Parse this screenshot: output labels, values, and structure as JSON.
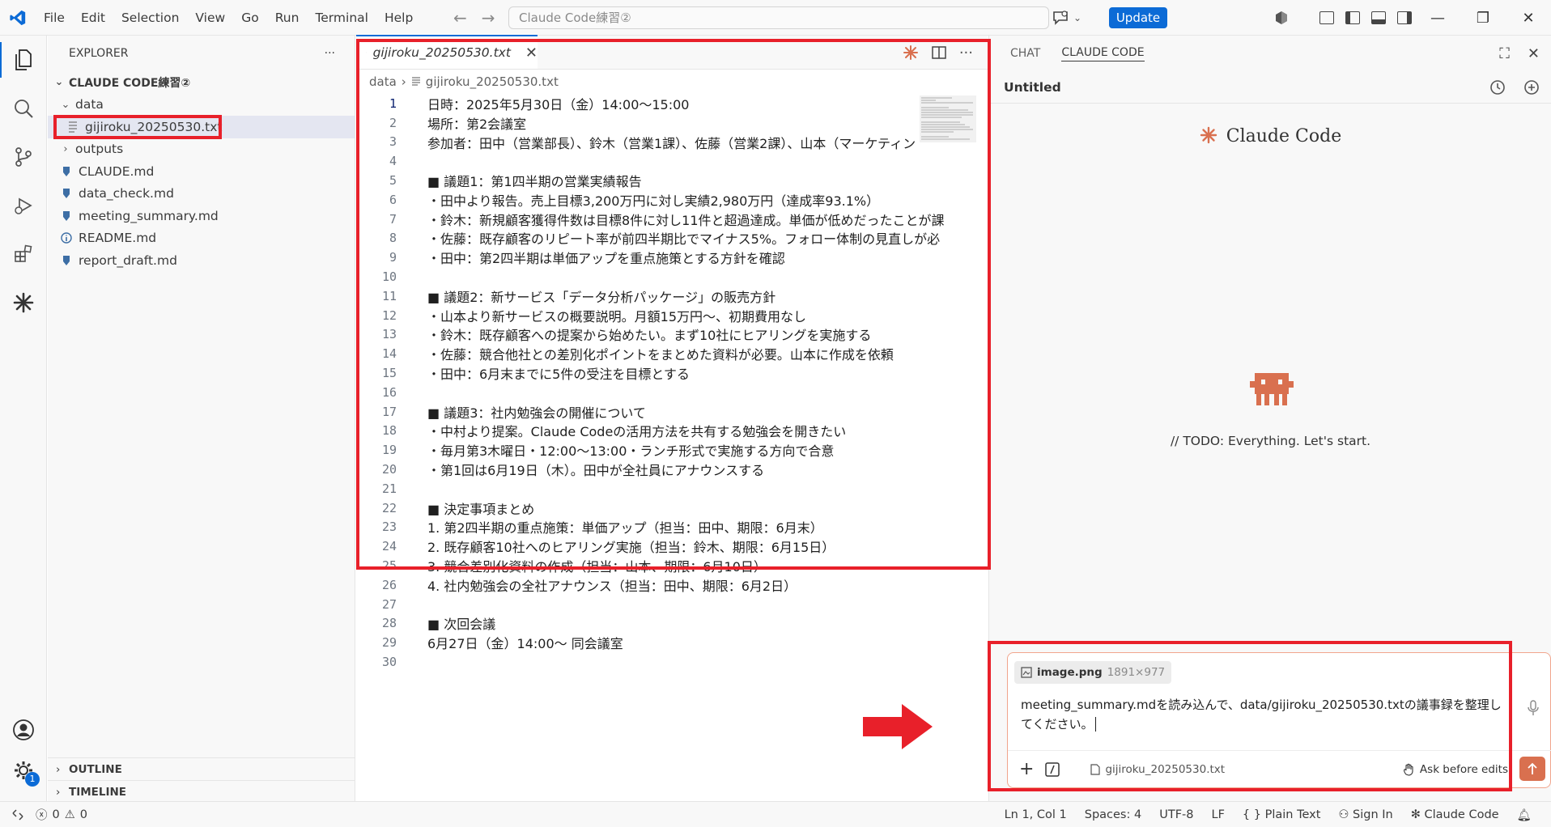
{
  "titlebar": {
    "menu": [
      "File",
      "Edit",
      "Selection",
      "View",
      "Go",
      "Run",
      "Terminal",
      "Help"
    ],
    "search_text": "Claude Code練習②",
    "update_label": "Update"
  },
  "explorer": {
    "title": "EXPLORER",
    "more": "···",
    "root": "CLAUDE CODE練習②",
    "folder_data": "data",
    "selected_file": "gijiroku_20250530.txt",
    "folder_outputs": "outputs",
    "files": [
      "CLAUDE.md",
      "data_check.md",
      "meeting_summary.md",
      "README.md",
      "report_draft.md"
    ],
    "outline": "OUTLINE",
    "timeline": "TIMELINE",
    "settings_badge": "1"
  },
  "editor": {
    "tab_label": "gijiroku_20250530.txt",
    "breadcrumb_folder": "data",
    "breadcrumb_file": "gijiroku_20250530.txt",
    "lines": [
      "日時：2025年5月30日（金）14:00〜15:00",
      "場所：第2会議室",
      "参加者：田中（営業部長）、鈴木（営業1課）、佐藤（営業2課）、山本（マーケティン",
      "",
      "■ 議題1：第1四半期の営業実績報告",
      "・田中より報告。売上目標3,200万円に対し実績2,980万円（達成率93.1%）",
      "・鈴木：新規顧客獲得件数は目標8件に対し11件と超過達成。単価が低めだったことが課",
      "・佐藤：既存顧客のリピート率が前四半期比でマイナス5%。フォロー体制の見直しが必",
      "・田中：第2四半期は単価アップを重点施策とする方針を確認",
      "",
      "■ 議題2：新サービス「データ分析パッケージ」の販売方針",
      "・山本より新サービスの概要説明。月額15万円〜、初期費用なし",
      "・鈴木：既存顧客への提案から始めたい。まず10社にヒアリングを実施する",
      "・佐藤：競合他社との差別化ポイントをまとめた資料が必要。山本に作成を依頼",
      "・田中：6月末までに5件の受注を目標とする",
      "",
      "■ 議題3：社内勉強会の開催について",
      "・中村より提案。Claude Codeの活用方法を共有する勉強会を開きたい",
      "・毎月第3木曜日・12:00〜13:00・ランチ形式で実施する方向で合意",
      "・第1回は6月19日（木）。田中が全社員にアナウンスする",
      "",
      "■ 決定事項まとめ",
      "1. 第2四半期の重点施策：単価アップ（担当：田中、期限：6月末）",
      "2. 既存顧客10社へのヒアリング実施（担当：鈴木、期限：6月15日）",
      "3. 競合差別化資料の作成（担当：山本、期限：6月10日）",
      "4. 社内勉強会の全社アナウンス（担当：田中、期限：6月2日）",
      "",
      "■ 次回会議",
      "6月27日（金）14:00〜 同会議室",
      ""
    ]
  },
  "panel": {
    "tab_chat": "CHAT",
    "tab_claude": "CLAUDE CODE",
    "session_title": "Untitled",
    "brand": "Claude Code",
    "todo": "// TODO: Everything. Let's start.",
    "attachment_name": "image.png",
    "attachment_size": "1891×977",
    "prompt": "meeting_summary.mdを読み込んで、data/gijiroku_20250530.txtの議事録を整理してください。",
    "context_file": "gijiroku_20250530.txt",
    "ask_before_edits": "Ask before edits"
  },
  "status": {
    "errors": "0",
    "warnings": "0",
    "position": "Ln 1, Col 1",
    "spaces": "Spaces: 4",
    "encoding": "UTF-8",
    "eol": "LF",
    "language": "Plain Text",
    "sign_in": "Sign In",
    "claude": "Claude Code"
  },
  "colors": {
    "accent": "#0c6bd6",
    "claude_orange": "#d9704f",
    "annotation_red": "#e8202a"
  }
}
